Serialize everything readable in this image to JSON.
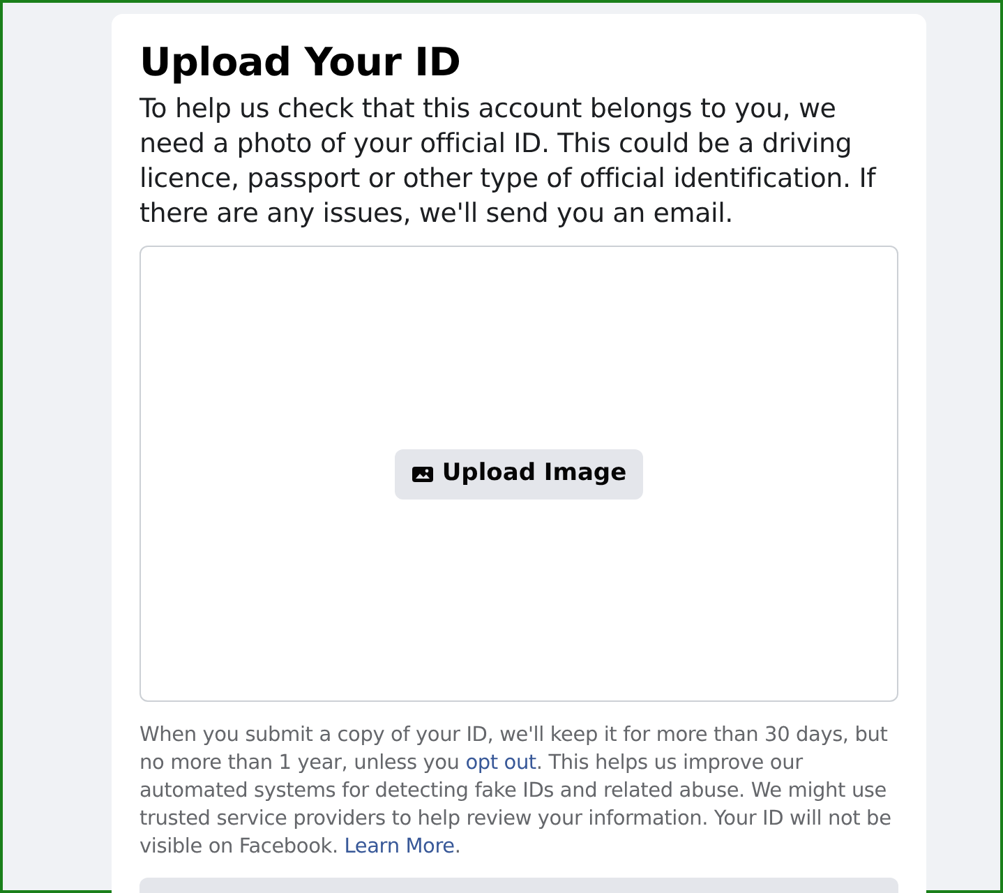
{
  "title": "Upload Your ID",
  "description": "To help us check that this account belongs to you, we need a photo of your official ID. This could be a driving licence, passport or other type of official identification. If there are any issues, we'll send you an email.",
  "upload_button": {
    "label": "Upload Image"
  },
  "notice": [
    {
      "kind": "text",
      "text": "When you submit a copy of your ID, we'll keep it for more than 30 days, but no more than 1 year, unless you "
    },
    {
      "kind": "link",
      "text": "opt out"
    },
    {
      "kind": "text",
      "text": ". This helps us improve our automated systems for detecting fake IDs and related abuse. We might use trusted service providers to help review your information. Your ID will not be visible on Facebook. "
    },
    {
      "kind": "link",
      "text": "Learn More"
    },
    {
      "kind": "text",
      "text": "."
    }
  ]
}
